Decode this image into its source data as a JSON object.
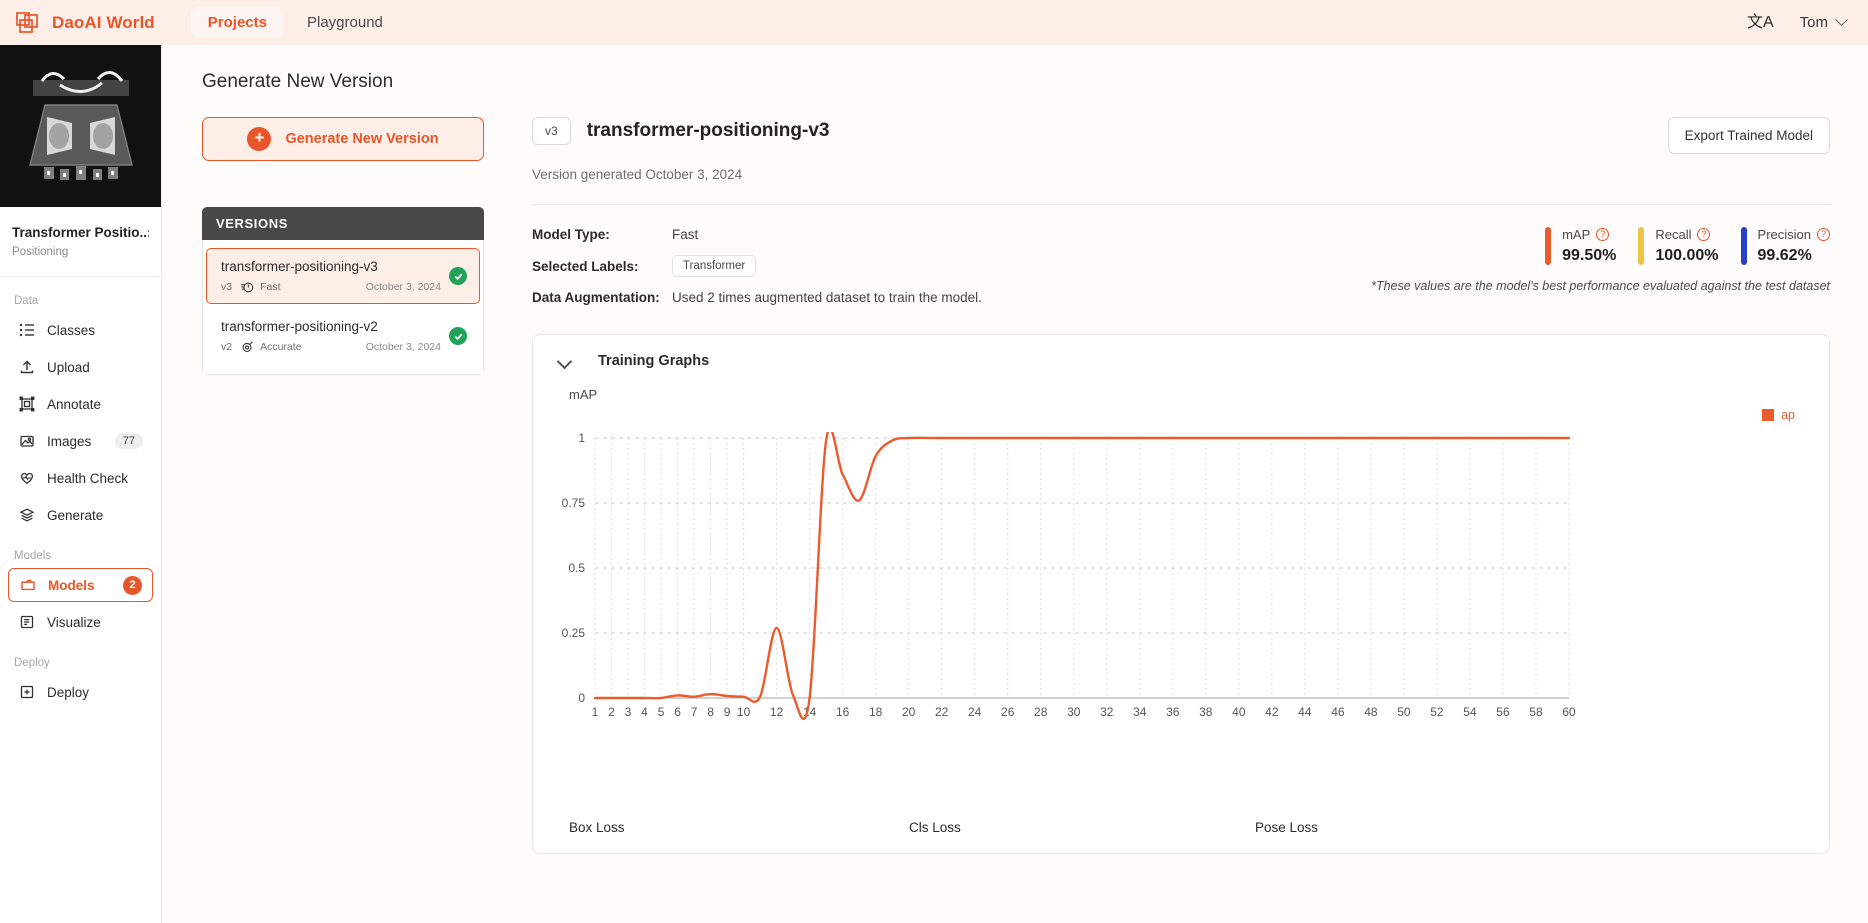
{
  "topbar": {
    "brand": "DaoAI World",
    "logo_icon": "overlapping-squares-icon",
    "tabs": [
      {
        "label": "Projects",
        "active": true
      },
      {
        "label": "Playground",
        "active": false
      }
    ],
    "language_icon": "translate-icon",
    "language_glyph": "文A",
    "user": "Tom",
    "user_chevron_icon": "chevron-down-icon"
  },
  "sidebar": {
    "project_title": "Transformer Positio..:",
    "project_subtitle": "Positioning",
    "groups": [
      {
        "label": "Data",
        "items": [
          {
            "label": "Classes",
            "icon": "list-icon",
            "badge": null,
            "active": false
          },
          {
            "label": "Upload",
            "icon": "upload-icon",
            "badge": null,
            "active": false
          },
          {
            "label": "Annotate",
            "icon": "annotate-icon",
            "badge": null,
            "active": false
          },
          {
            "label": "Images",
            "icon": "image-icon",
            "badge": "77",
            "active": false
          },
          {
            "label": "Health Check",
            "icon": "heart-pulse-icon",
            "badge": null,
            "active": false
          },
          {
            "label": "Generate",
            "icon": "layers-icon",
            "badge": null,
            "active": false
          }
        ]
      },
      {
        "label": "Models",
        "items": [
          {
            "label": "Models",
            "icon": "folder-icon",
            "badge": "2",
            "active": true
          },
          {
            "label": "Visualize",
            "icon": "panel-icon",
            "badge": null,
            "active": false
          }
        ]
      },
      {
        "label": "Deploy",
        "items": [
          {
            "label": "Deploy",
            "icon": "deploy-box-icon",
            "badge": null,
            "active": false
          }
        ]
      }
    ]
  },
  "main": {
    "page_title": "Generate New Version",
    "generate_button": {
      "label": "Generate New Version",
      "icon": "plus-circle-icon"
    },
    "versions_panel": {
      "header": "VERSIONS",
      "items": [
        {
          "name": "transformer-positioning-v3",
          "version": "v3",
          "type": "Fast",
          "type_icon": "speed-icon",
          "date": "October 3, 2024",
          "status_icon": "check-circle-icon",
          "selected": true
        },
        {
          "name": "transformer-positioning-v2",
          "version": "v2",
          "type": "Accurate",
          "type_icon": "target-icon",
          "date": "October 3, 2024",
          "status_icon": "check-circle-icon",
          "selected": false
        }
      ]
    },
    "model": {
      "version_chip": "v3",
      "name": "transformer-positioning-v3",
      "subtitle": "Version generated October 3, 2024",
      "export_button": "Export Trained Model",
      "info": [
        {
          "key": "Model Type:",
          "value": "Fast",
          "chip": false
        },
        {
          "key": "Selected Labels:",
          "value": "Transformer",
          "chip": true
        },
        {
          "key": "Data Augmentation:",
          "value": "Used 2 times augmented dataset to train the model.",
          "chip": false
        }
      ],
      "metrics": [
        {
          "label": "mAP",
          "value": "99.50%",
          "color": "#ea5b2d",
          "help_icon": "help-circle-icon"
        },
        {
          "label": "Recall",
          "value": "100.00%",
          "color": "#f0c245",
          "help_icon": "help-circle-icon"
        },
        {
          "label": "Precision",
          "value": "99.62%",
          "color": "#2542c4",
          "help_icon": "help-circle-icon"
        }
      ],
      "metrics_note": "*These values are the model's best performance evaluated against the test dataset"
    },
    "graphs": {
      "title": "Training Graphs",
      "collapse_icon": "chevron-down-icon",
      "loss_labels": [
        "Box Loss",
        "Cls Loss",
        "Pose Loss"
      ]
    }
  },
  "chart_data": {
    "type": "line",
    "title": "mAP",
    "xlabel": "",
    "ylabel": "mAP",
    "ylim": [
      0,
      1
    ],
    "yticks": [
      0,
      0.25,
      0.5,
      0.75,
      1
    ],
    "ytick_labels": [
      "0",
      "0.25",
      "0.5",
      "0.75",
      "1"
    ],
    "xlim": [
      1,
      60
    ],
    "xticks": [
      1,
      2,
      3,
      4,
      5,
      6,
      7,
      8,
      9,
      10,
      12,
      14,
      16,
      18,
      20,
      22,
      24,
      26,
      28,
      30,
      32,
      34,
      36,
      38,
      40,
      42,
      44,
      46,
      48,
      50,
      52,
      54,
      56,
      58,
      60
    ],
    "grid": true,
    "legend": [
      {
        "name": "ap",
        "color": "#ea5b2d"
      }
    ],
    "legend_position": "top-right",
    "series": [
      {
        "name": "ap",
        "color": "#ea5b2d",
        "x": [
          1,
          2,
          3,
          4,
          5,
          6,
          7,
          8,
          9,
          10,
          11,
          12,
          13,
          14,
          15,
          16,
          17,
          18,
          19,
          20,
          22,
          24,
          26,
          28,
          30,
          32,
          34,
          36,
          38,
          40,
          42,
          44,
          46,
          48,
          50,
          52,
          54,
          56,
          58,
          60
        ],
        "values": [
          0,
          0,
          0,
          0,
          0,
          0.01,
          0.005,
          0.015,
          0.008,
          0.005,
          0.005,
          0.27,
          0.01,
          0.0,
          0.99,
          0.86,
          0.76,
          0.93,
          0.99,
          1,
          1,
          1,
          1,
          1,
          1,
          1,
          1,
          1,
          1,
          1,
          1,
          1,
          1,
          1,
          1,
          1,
          1,
          1,
          1,
          1
        ]
      }
    ]
  }
}
